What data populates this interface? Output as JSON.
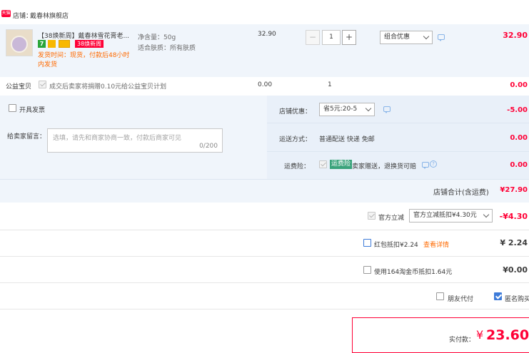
{
  "shop": {
    "badge": "天猫",
    "label": "店铺：",
    "name": "戴春林旗舰店"
  },
  "item": {
    "title": "【38焕新周】戴春林雪花膏老...",
    "promo_tag": "38焕新周",
    "shipping_note": "发货时间：现货，付款后48小时内发货",
    "sku_label1": "净含量：50g",
    "sku_label2": "适合肤质：所有肤质",
    "price": "32.90",
    "quantity": "1",
    "promo_select": "组合优惠",
    "subtotal": "32.90"
  },
  "charity": {
    "label": "公益宝贝",
    "text": "成交后卖家将捐赠0.10元给公益宝贝计划",
    "price": "0.00",
    "qty": "1",
    "total": "0.00"
  },
  "invoice": {
    "label": "开具发票"
  },
  "message": {
    "label": "给卖家留言：",
    "placeholder": "选填，请先和商家协商一致，付款后商家可见",
    "counter": "0/200"
  },
  "store_discount": {
    "label": "店铺优惠：",
    "select": "省5元:20-5",
    "amount": "-5.00"
  },
  "delivery": {
    "label": "运送方式：",
    "method": "普通配送 快递 免邮",
    "amount": "0.00"
  },
  "insurance": {
    "label": "运费险：",
    "tag": "运费险",
    "text": "卖家赠送，退换货可赔",
    "amount": "0.00"
  },
  "shop_total": {
    "label": "店铺合计(含运费)",
    "amount": "¥27.90"
  },
  "official_discount": {
    "label": "官方立减",
    "select": "官方立减抵扣¥4.30元",
    "amount": "-¥4.30"
  },
  "red_packet": {
    "label": "红包抵扣¥2.24",
    "link": "查看详情",
    "amount": "¥ 2.24"
  },
  "coins": {
    "label": "使用164淘金币抵扣1.64元",
    "amount": "¥0.00"
  },
  "friend_pay": {
    "label": "朋友代付"
  },
  "anonymous": {
    "label": "匿名购买"
  },
  "payment": {
    "label": "实付款：",
    "currency": "¥",
    "amount": "23.60"
  },
  "colors": {
    "accent": "#ff0036",
    "link": "#ff6a00",
    "panel": "#f0f5fb",
    "check": "#3d7bd9"
  }
}
